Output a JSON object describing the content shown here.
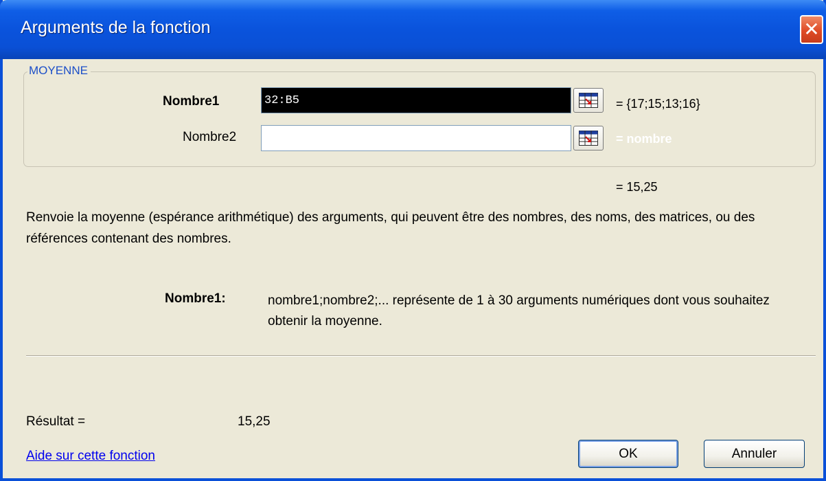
{
  "window": {
    "title": "Arguments de la fonction",
    "close_glyph": "✕"
  },
  "function_group": {
    "name": "MOYENNE",
    "args": [
      {
        "label": "Nombre1",
        "value": "32:B5",
        "result": "= {17;15;13;16}",
        "bold": true,
        "selected": true
      },
      {
        "label": "Nombre2",
        "value": "",
        "result": "= nombre",
        "bold": false,
        "selected": false
      }
    ]
  },
  "formula_result_line": "= 15,25",
  "description": "Renvoie la moyenne (espérance arithmétique) des arguments, qui peuvent être des nombres, des noms, des matrices, ou des références contenant des nombres.",
  "arg_help": {
    "label": "Nombre1:",
    "text": "nombre1;nombre2;... représente de 1 à 30 arguments numériques dont vous souhaitez obtenir la moyenne."
  },
  "result": {
    "label": "Résultat =",
    "value": "15,25"
  },
  "help_link": "Aide sur cette fonction",
  "buttons": {
    "ok": "OK",
    "cancel": "Annuler"
  },
  "icons": {
    "collapse": "range-select-icon",
    "close": "close-icon"
  },
  "colors": {
    "titlebar": "#0a53dc",
    "dialog_bg": "#ece9d8",
    "legend": "#1c4fc8",
    "link": "#0000ee",
    "placeholder_result": "#ffffff",
    "close_button": "#df4b26"
  }
}
